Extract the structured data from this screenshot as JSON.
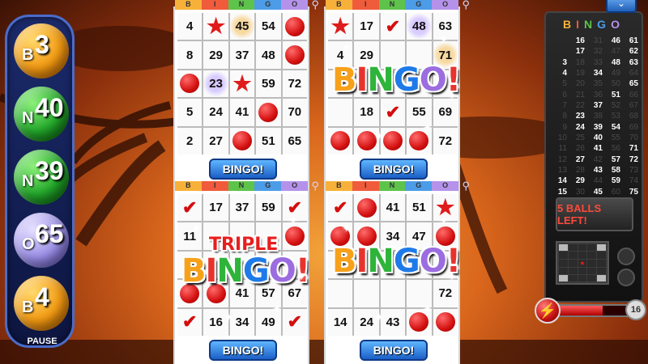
{
  "called_balls": [
    {
      "letter": "B",
      "number": "3",
      "color": "orange"
    },
    {
      "letter": "N",
      "number": "40",
      "color": "green"
    },
    {
      "letter": "N",
      "number": "39",
      "color": "green"
    },
    {
      "letter": "O",
      "number": "65",
      "color": "purple"
    },
    {
      "letter": "B",
      "number": "4",
      "color": "orange"
    }
  ],
  "pause_label": "PAUSE",
  "card_header": [
    "B",
    "I",
    "N",
    "G",
    "O"
  ],
  "cards": [
    {
      "button": "BINGO!",
      "overlay": "",
      "cells": [
        [
          "4",
          "★",
          "45",
          "54",
          "●"
        ],
        [
          "8",
          "29",
          "37",
          "48",
          "●"
        ],
        [
          "●",
          "23",
          "★",
          "59",
          "72"
        ],
        [
          "5",
          "24",
          "41",
          "●",
          "70"
        ],
        [
          "2",
          "27",
          "●",
          "51",
          "65"
        ]
      ]
    },
    {
      "button": "BINGO!",
      "overlay": "BINGO!",
      "cells": [
        [
          "★",
          "17",
          "✔",
          "48",
          "63"
        ],
        [
          "4",
          "29",
          "",
          "",
          "71"
        ],
        [
          "",
          "",
          "",
          "",
          ""
        ],
        [
          "",
          "18",
          "✔",
          "55",
          "69"
        ],
        [
          "●",
          "●",
          "●",
          "●",
          "72"
        ]
      ]
    },
    {
      "button": "BINGO!",
      "overlay": "BINGO!",
      "overlay_top": "TRIPLE",
      "cells": [
        [
          "✔",
          "17",
          "37",
          "59",
          "✔"
        ],
        [
          "11",
          "",
          "",
          "",
          "●"
        ],
        [
          "",
          "",
          "",
          "",
          ""
        ],
        [
          "●",
          "●",
          "41",
          "57",
          "67"
        ],
        [
          "✔",
          "16",
          "34",
          "49",
          "✔"
        ]
      ]
    },
    {
      "button": "BINGO!",
      "overlay": "BINGO!",
      "cells": [
        [
          "✔",
          "●",
          "41",
          "51",
          "★"
        ],
        [
          "●",
          "●",
          "34",
          "47",
          "●"
        ],
        [
          "",
          "",
          "",
          "",
          ""
        ],
        [
          "",
          "",
          "",
          "",
          "72"
        ],
        [
          "14",
          "24",
          "43",
          "●",
          "●"
        ]
      ]
    }
  ],
  "right_panel": {
    "title": [
      "B",
      "I",
      "N",
      "G",
      "O"
    ],
    "called_numbers": [
      [
        "",
        "16",
        "31",
        "46",
        "61"
      ],
      [
        "",
        "17",
        "32",
        "47",
        "62"
      ],
      [
        "3",
        "18",
        "33",
        "48",
        "63"
      ],
      [
        "4",
        "19",
        "34",
        "49",
        "64"
      ],
      [
        "5",
        "20",
        "35",
        "50",
        "65"
      ],
      [
        "6",
        "21",
        "36",
        "51",
        "66"
      ],
      [
        "7",
        "22",
        "37",
        "52",
        "67"
      ],
      [
        "8",
        "23",
        "38",
        "53",
        "68"
      ],
      [
        "9",
        "24",
        "39",
        "54",
        "69"
      ],
      [
        "10",
        "25",
        "40",
        "55",
        "70"
      ],
      [
        "11",
        "26",
        "41",
        "56",
        "71"
      ],
      [
        "12",
        "27",
        "42",
        "57",
        "72"
      ],
      [
        "13",
        "28",
        "43",
        "58",
        "73"
      ],
      [
        "14",
        "29",
        "44",
        "59",
        "74"
      ],
      [
        "15",
        "30",
        "45",
        "60",
        "75"
      ]
    ],
    "balls_left": "5 BALLS LEFT!",
    "power_count": "16"
  },
  "colors": {
    "b": "#f7b13a",
    "i": "#f05b3b",
    "n": "#5ec34a",
    "g": "#4c9ce8",
    "o": "#b592ea",
    "daub_red": "#d41010"
  },
  "power_fill": 0.6
}
